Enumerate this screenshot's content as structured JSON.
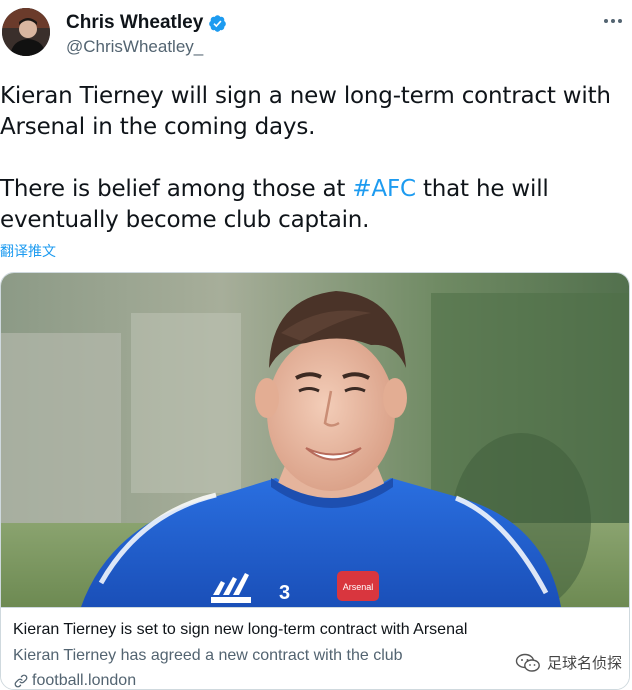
{
  "author": {
    "display_name": "Chris Wheatley",
    "handle": "@ChrisWheatley_",
    "verified": true
  },
  "tweet": {
    "paragraph1": "Kieran Tierney will sign a new long-term contract with Arsenal in the coming days.",
    "paragraph2_before": "There is belief among those at ",
    "hashtag": "#AFC",
    "paragraph2_after": " that he will eventually become club captain.",
    "translate_label": "翻译推文"
  },
  "card": {
    "title": "Kieran Tierney is set to sign new long-term contract with Arsenal",
    "description": "Kieran Tierney has agreed a new contract with the club",
    "domain": "football.london",
    "image_icon": "player-photo",
    "shirt_badge": "Arsenal",
    "shirt_number": "3"
  },
  "watermark": {
    "text": "足球名侦探",
    "icon": "wechat-icon"
  },
  "colors": {
    "accent": "#1d9bf0",
    "text": "#0f1419",
    "secondary": "#536471",
    "border": "#cfd9de",
    "kit_blue": "#1f5fd0"
  }
}
